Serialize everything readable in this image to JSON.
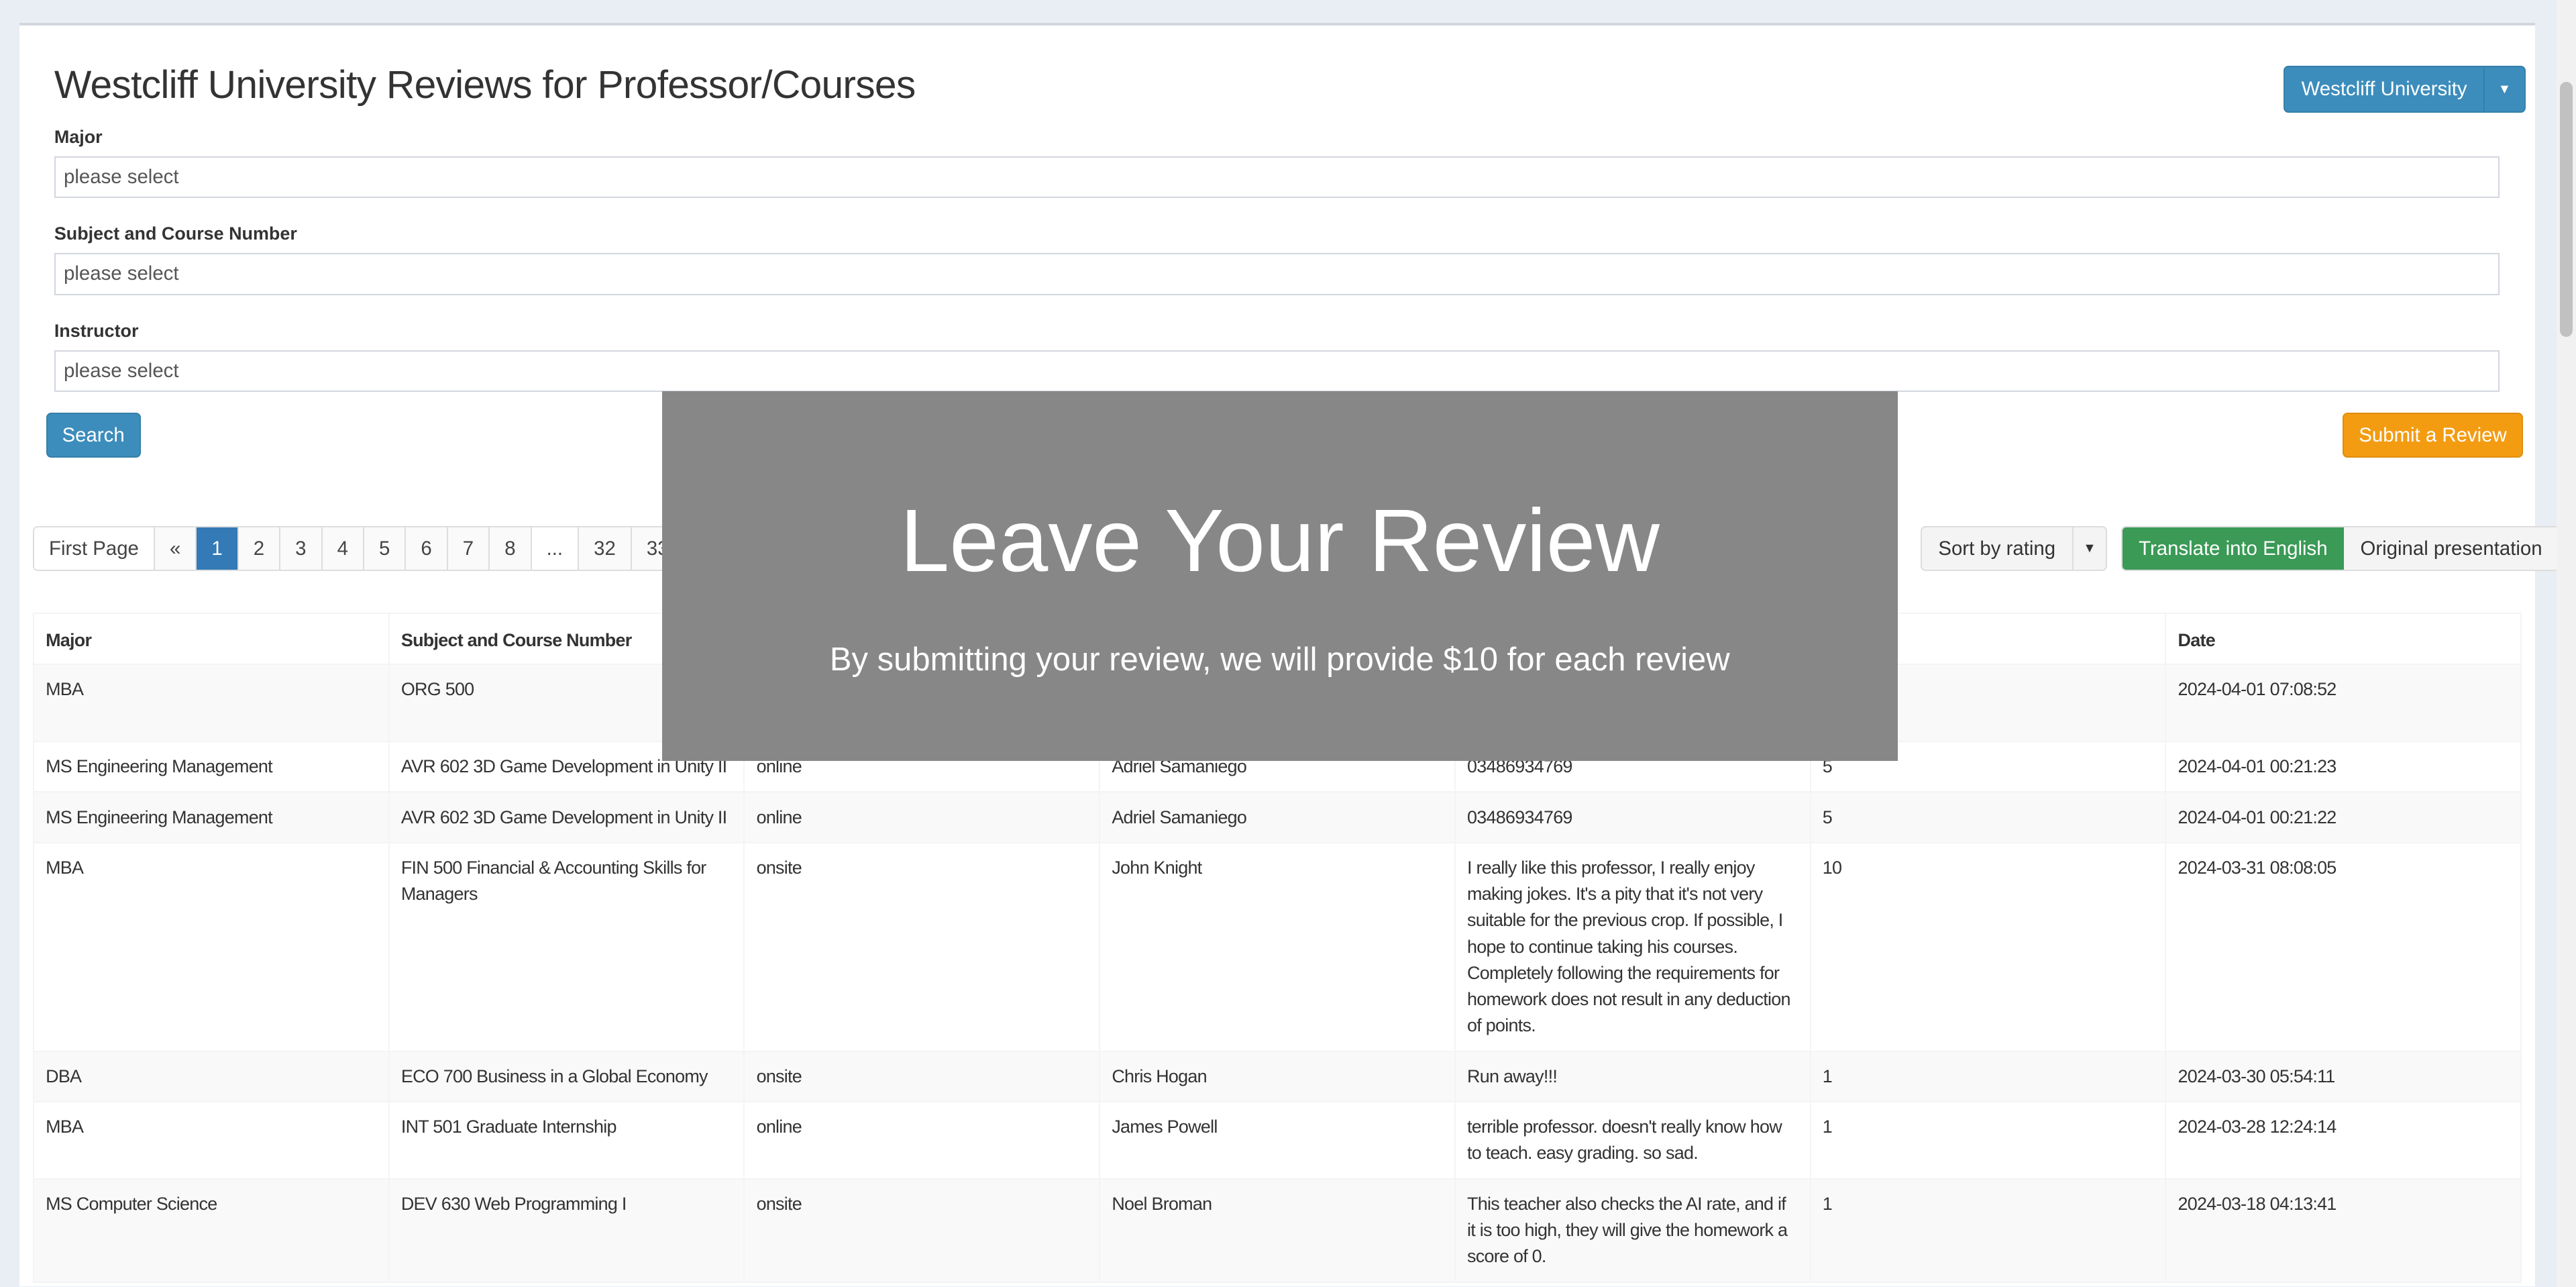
{
  "header": {
    "title": "Westcliff University Reviews for Professor/Courses",
    "university_button": "Westcliff University"
  },
  "filters": [
    {
      "label": "Major",
      "placeholder": "please select"
    },
    {
      "label": "Subject and Course Number",
      "placeholder": "please select"
    },
    {
      "label": "Instructor",
      "placeholder": "please select"
    }
  ],
  "buttons": {
    "search": "Search",
    "submit_review": "Submit a Review",
    "sort": "Sort by rating",
    "translate": "Translate into English",
    "original": "Original presentation"
  },
  "pagination": [
    "First Page",
    "«",
    "1",
    "2",
    "3",
    "4",
    "5",
    "6",
    "7",
    "8",
    "...",
    "32",
    "33"
  ],
  "pagination_active": "1",
  "overlay": {
    "title": "Leave Your Review",
    "subtitle": "By submitting your review, we will provide $10 for each review"
  },
  "table": {
    "headers": [
      "Major",
      "Subject and Course Number",
      "",
      "",
      "",
      "",
      "Date"
    ],
    "rows": [
      [
        "MBA",
        "ORG 500",
        "",
        "",
        "",
        "",
        "2024-04-01 07:08:52"
      ],
      [
        "MS Engineering Management",
        "AVR 602 3D Game Development in Unity II",
        "online",
        "Adriel Samaniego",
        "03486934769",
        "5",
        "2024-04-01 00:21:23"
      ],
      [
        "MS Engineering Management",
        "AVR 602 3D Game Development in Unity II",
        "online",
        "Adriel Samaniego",
        "03486934769",
        "5",
        "2024-04-01 00:21:22"
      ],
      [
        "MBA",
        "FIN 500 Financial & Accounting Skills for Managers",
        "onsite",
        "John Knight",
        "I really like this professor, I really enjoy making jokes. It's a pity that it's not very suitable for the previous crop. If possible, I hope to continue taking his courses. Completely following the requirements for homework does not result in any deduction of points.",
        "10",
        "2024-03-31 08:08:05"
      ],
      [
        "DBA",
        "ECO 700 Business in a Global Economy",
        "onsite",
        "Chris Hogan",
        "Run away!!!",
        "1",
        "2024-03-30 05:54:11"
      ],
      [
        "MBA",
        "INT 501 Graduate Internship",
        "online",
        "James Powell",
        "terrible professor. doesn't really know how to teach. easy grading. so sad.",
        "1",
        "2024-03-28 12:24:14"
      ],
      [
        "MS Computer Science",
        "DEV 630 Web Programming I",
        "onsite",
        "Noel Broman",
        "This teacher also checks the AI rate, and if it is too high, they will give the homework a score of 0.",
        "1",
        "2024-03-18 04:13:41"
      ]
    ]
  },
  "colors": {
    "primary": "#3c8dbc",
    "warning": "#f39c12",
    "success": "#3a9a56",
    "overlay": "#878787",
    "active_page": "#337ab7"
  }
}
